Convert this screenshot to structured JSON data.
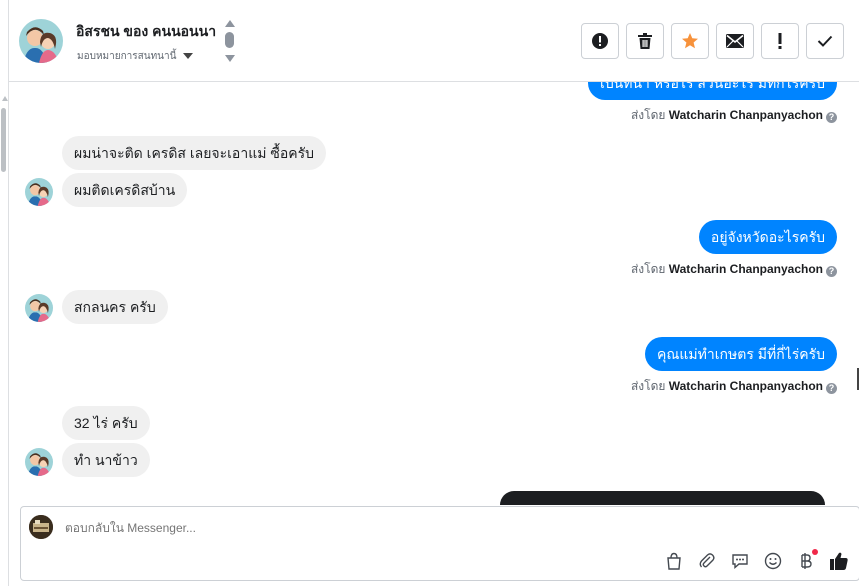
{
  "header": {
    "contact_name": "อิสรชน ของ คนนอนนา",
    "assign_label": "มอบหมายการสนทนานี้",
    "actions": [
      {
        "icon": "alert-circle-icon",
        "name": "mark-spam-button"
      },
      {
        "icon": "trash-icon",
        "name": "delete-button"
      },
      {
        "icon": "star-icon",
        "name": "star-button"
      },
      {
        "icon": "envelope-icon",
        "name": "mark-unread-button"
      },
      {
        "icon": "exclamation-icon",
        "name": "follow-up-button"
      },
      {
        "icon": "check-icon",
        "name": "mark-done-button"
      }
    ],
    "star_color": "#f7923b"
  },
  "messages": {
    "out_partial": "เป็นที่นา หรือไร่ สวนอะไร มีที่กี่ไร่ครับ",
    "sent_prefix": "ส่งโดย",
    "sender": "Watcharin Chanpanyachon",
    "help_glyph": "?",
    "in_1": "ผมน่าจะติด เครดิส เลยจะเอาแม่ ซื้อครับ",
    "in_2": "ผมติดเครดิสบ้าน",
    "out_2": "อยู่จังหวัดอะไรครับ",
    "in_3": "สกลนคร ครับ",
    "out_3": "คุณแม่ทำเกษตร มีที่กี่ไร่ครับ",
    "in_4": "32 ไร่ ครับ",
    "in_5": "ทำ นาข้าว"
  },
  "composer": {
    "placeholder": "ตอบกลับใน Messenger...",
    "tools": [
      "shopping-bag-icon",
      "paperclip-icon",
      "saved-replies-icon",
      "emoji-icon",
      "baht-payment-icon",
      "like-icon"
    ]
  },
  "colors": {
    "outgoing_bubble": "#0084ff",
    "incoming_bubble": "#f0f0f0",
    "notification_dot": "#f02849"
  }
}
